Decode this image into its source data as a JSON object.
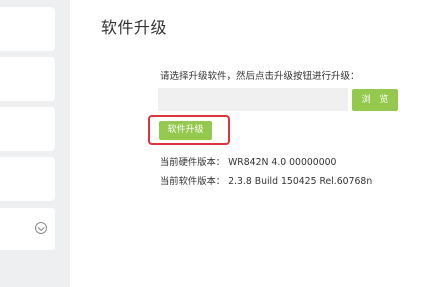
{
  "page": {
    "title": "软件升级"
  },
  "sidebar": {
    "items": [
      "",
      "",
      "",
      "",
      ""
    ],
    "expand_icon": "chevron-down-circle-icon"
  },
  "upgrade": {
    "instruction": "请选择升级软件，然后点击升级按钮进行升级：",
    "file_value": "",
    "browse_label": "浏 览",
    "upgrade_label": "软件升级",
    "highlight_color": "#e0323c",
    "button_color": "#94c94e"
  },
  "versions": {
    "hardware_label": "当前硬件版本：",
    "hardware_value": "WR842N 4.0 00000000",
    "software_label": "当前软件版本：",
    "software_value": "2.3.8 Build 150425 Rel.60768n"
  }
}
